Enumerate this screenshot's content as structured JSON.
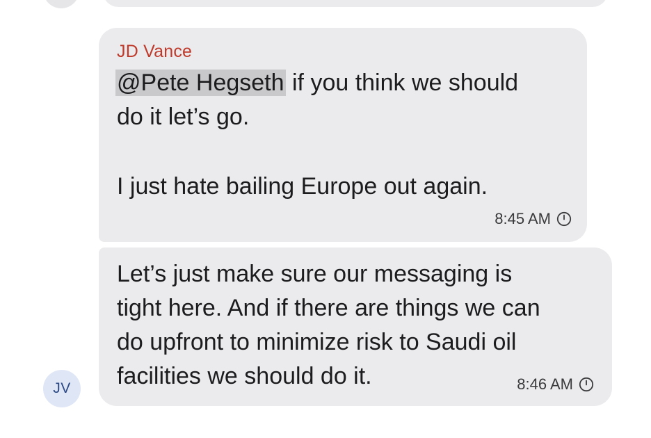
{
  "thread": {
    "messages": [
      {
        "sender": "JD Vance",
        "mention": "@Pete Hegseth",
        "line1_rest": " if you think we should",
        "line2": "do it let’s go.",
        "para2": "I just hate bailing Europe out again.",
        "time": "8:45 AM"
      },
      {
        "lines": [
          "Let’s just make sure our messaging is",
          "tight here. And if there are things we can",
          "do upfront to minimize risk to Saudi oil",
          "facilities we should do it."
        ],
        "time": "8:46 AM"
      }
    ],
    "avatar_initials": "JV"
  },
  "colors": {
    "sender_name": "#bf3a2b",
    "bubble_bg": "#ebebed",
    "mention_bg": "#c9c9cc",
    "avatar_bg": "#dfe6f5",
    "avatar_text": "#2d4a86"
  },
  "icons": {
    "status": "clock-icon"
  }
}
